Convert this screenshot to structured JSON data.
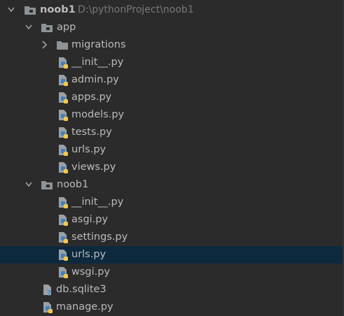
{
  "tree": {
    "root": {
      "name": "noob1",
      "path": "D:\\pythonProject\\noob1"
    },
    "app": {
      "name": "app",
      "migrations": "migrations",
      "files": [
        "__init__.py",
        "admin.py",
        "apps.py",
        "models.py",
        "tests.py",
        "urls.py",
        "views.py"
      ]
    },
    "pkg": {
      "name": "noob1",
      "files": [
        "__init__.py",
        "asgi.py",
        "settings.py",
        "urls.py",
        "wsgi.py"
      ]
    },
    "root_files": [
      "db.sqlite3",
      "manage.py"
    ]
  },
  "colors": {
    "background": "#2b2b2b",
    "selection": "#0d293e",
    "text": "#bbbbbb",
    "path_text": "#787878",
    "folder": "#8d9396",
    "python_blue": "#3f7fbf",
    "python_yellow": "#f2c94c"
  },
  "icons": {
    "expanded": "chevron-down-icon",
    "collapsed": "chevron-right-icon",
    "folder": "folder-icon",
    "python_file": "python-file-icon",
    "database_file": "sqlite-unknown-file-icon"
  }
}
